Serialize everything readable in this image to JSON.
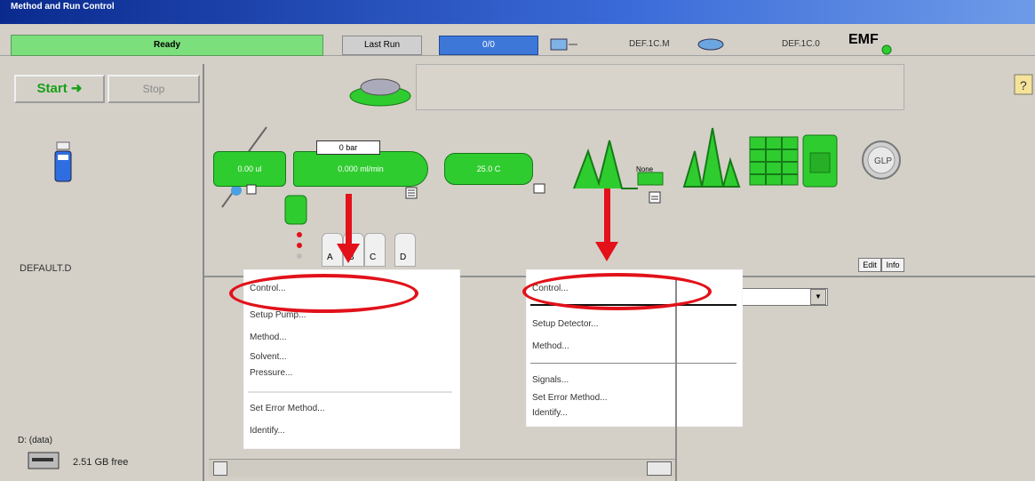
{
  "window": {
    "title": "Method and Run Control"
  },
  "status_bar": {
    "state": "Ready",
    "last_run_label": "Last Run",
    "run_value": "0/0",
    "pressure_a": "DEF.1C.M",
    "pressure_b": "DEF.1C.0",
    "emf_label": "EMF"
  },
  "left_panel": {
    "start_label": "Start",
    "stop_label": "Stop",
    "method_name": "DEFAULT.D",
    "disk_label": "D: (data)",
    "disk_free": "2.51 GB free"
  },
  "modules": {
    "injector_value": "0.00 ul",
    "pump_flow_value": "0.000 ml/min",
    "pump_pressure_value": "0 bar",
    "column_temp_value": "25.0 C",
    "detector_label": "None",
    "solvent_bottles": [
      "A",
      "B",
      "C",
      "D"
    ],
    "glp_label": "GLP",
    "ctrl_buttons": [
      "Edit",
      "Info"
    ]
  },
  "popup_left": {
    "items": [
      "Control...",
      "Setup Pump...",
      "Method...",
      "Solvent...",
      "Pressure...",
      "Set Error Method...",
      "Identify..."
    ]
  },
  "popup_right": {
    "items": [
      "Control...",
      "Setup Detector...",
      "Method...",
      "Signals...",
      "Set Error Method...",
      "Identify..."
    ]
  },
  "colors": {
    "accent_red": "#e2111a",
    "module_green": "#2fcc2f",
    "ready_green": "#7be07b",
    "run_blue": "#3d78d8"
  }
}
